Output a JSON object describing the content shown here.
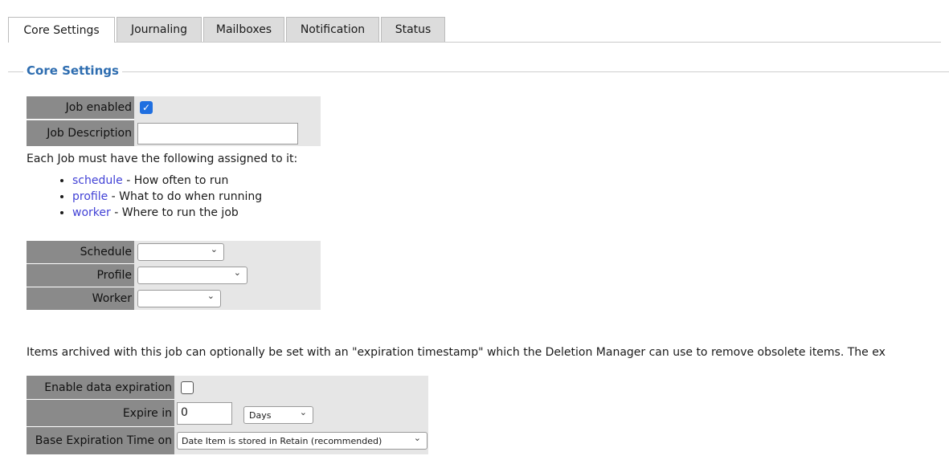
{
  "tabs": [
    {
      "label": "Core Settings",
      "active": true
    },
    {
      "label": "Journaling",
      "active": false
    },
    {
      "label": "Mailboxes",
      "active": false
    },
    {
      "label": "Notification",
      "active": false
    },
    {
      "label": "Status",
      "active": false
    }
  ],
  "core": {
    "legend": "Core Settings",
    "job_enabled_label": "Job enabled",
    "job_enabled_checked": true,
    "job_description_label": "Job Description",
    "job_description_value": "",
    "intro": "Each Job must have the following assigned to it:",
    "requirements": [
      {
        "term": "schedule",
        "desc": " - How often to run"
      },
      {
        "term": "profile",
        "desc": " - What to do when running"
      },
      {
        "term": "worker",
        "desc": " - Where to run the job"
      }
    ],
    "schedule_label": "Schedule",
    "schedule_value": "",
    "profile_label": "Profile",
    "profile_value": "",
    "worker_label": "Worker",
    "worker_value": ""
  },
  "expiration": {
    "note": "Items archived with this job can optionally be set with an \"expiration timestamp\" which the Deletion Manager can use to remove obsolete items. The ex",
    "enable_label": "Enable data expiration",
    "enable_checked": false,
    "expire_in_label": "Expire in",
    "expire_in_value": "0",
    "unit_value": "Days",
    "base_label": "Base Expiration Time on",
    "base_value": "Date Item is stored in Retain (recommended)"
  },
  "colors": {
    "accent": "#2e6db0",
    "link": "#4242d6",
    "label_bg": "#8a8a8a",
    "checkbox_on": "#1f6fe0"
  }
}
